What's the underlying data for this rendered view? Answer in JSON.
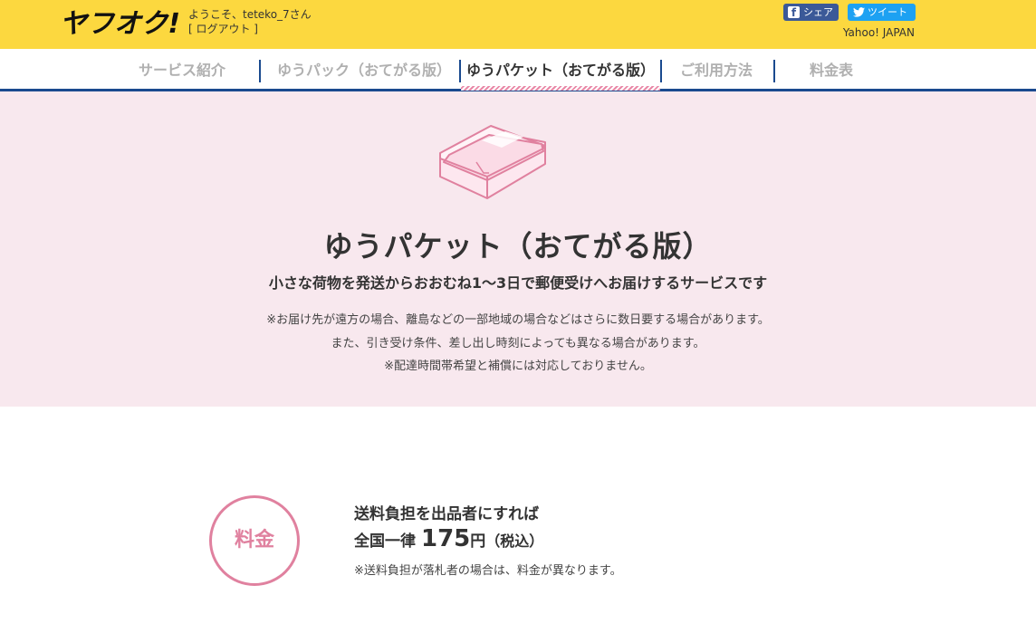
{
  "header": {
    "logo_text": "ヤフオク!",
    "welcome": "ようこそ、teteko_7さん",
    "logout": "[ ログアウト ]",
    "share_label": "シェア",
    "tweet_label": "ツイート",
    "yahoo_link": "Yahoo! JAPAN",
    "colors": {
      "header_bg": "#fcd83f",
      "facebook": "#3b5998",
      "twitter": "#1da1f2"
    }
  },
  "nav": {
    "items": [
      {
        "label": "サービス紹介",
        "active": false
      },
      {
        "label": "ゆうパック（おてがる版）",
        "active": false
      },
      {
        "label": "ゆうパケット（おてがる版）",
        "active": true
      },
      {
        "label": "ご利用方法",
        "active": false
      },
      {
        "label": "料金表",
        "active": false
      }
    ],
    "accent_color": "#1a4a8f"
  },
  "hero": {
    "icon": "package-box-icon",
    "title": "ゆうパケット（おてがる版）",
    "subtitle": "小さな荷物を発送からおおむね1～3日で郵便受けへお届けするサービスです",
    "notes": [
      "※お届け先が遠方の場合、離島などの一部地域の場合などはさらに数日要する場合があります。",
      "また、引き受け条件、差し出し時刻によっても異なる場合があります。",
      "※配達時間帯希望と補償には対応しておりません。"
    ],
    "bg_color": "#f8e8ee"
  },
  "fee": {
    "badge": "料金",
    "line1": "送料負担を出品者にすれば",
    "line2_prefix": "全国一律",
    "price": "175",
    "unit": "円",
    "tax": "（税込）",
    "note": "※送料負担が落札者の場合は、料金が異なります。",
    "accent_color": "#e0819f"
  }
}
